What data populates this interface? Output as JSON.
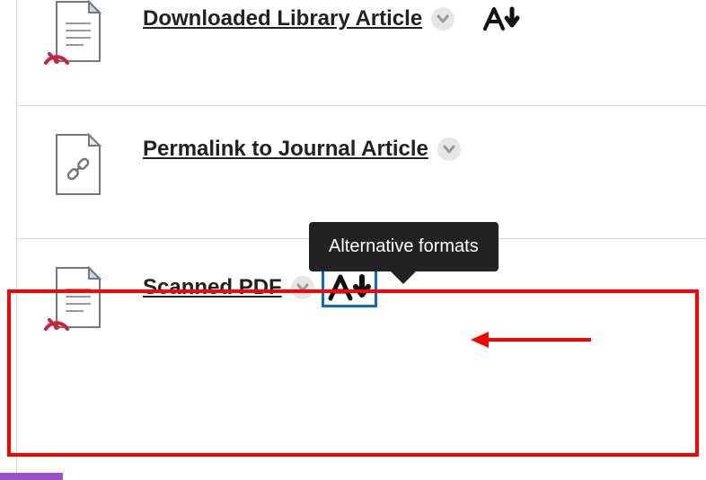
{
  "items": [
    {
      "title": "Downloaded Library Article",
      "icon": "document",
      "gauge": true,
      "alt_formats": true
    },
    {
      "title": "Permalink to Journal Article",
      "icon": "link",
      "gauge": false,
      "alt_formats": false
    },
    {
      "title": "Scanned PDF",
      "icon": "document",
      "gauge": true,
      "alt_formats": true,
      "selected": true
    }
  ],
  "tooltip": {
    "label": "Alternative formats"
  }
}
